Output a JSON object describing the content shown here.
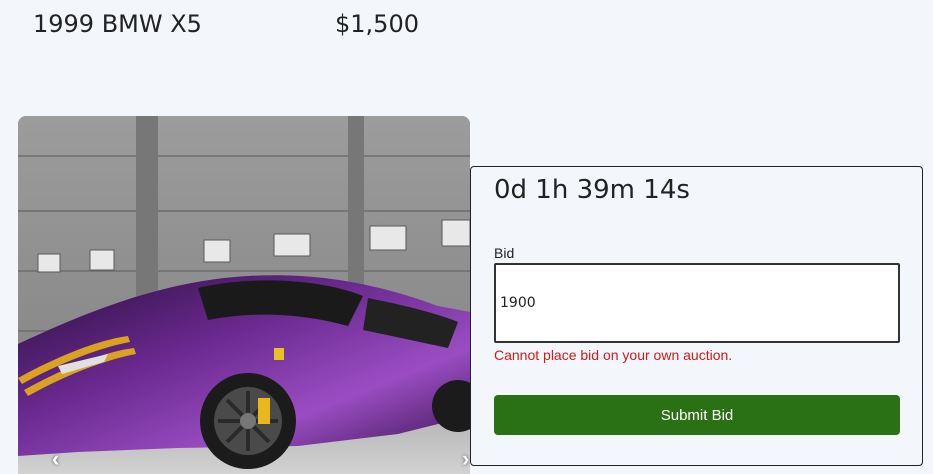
{
  "listing": {
    "title": "1999 BMW X5",
    "price": "$1,500"
  },
  "carousel": {
    "prev_arrow": "‹",
    "next_arrow": "›",
    "image_subject": "purple sports car in garage"
  },
  "bid_panel": {
    "countdown": "0d 1h 39m 14s",
    "bid_label": "Bid",
    "bid_value": "1900",
    "error_message": "Cannot place bid on your own auction.",
    "submit_label": "Submit Bid"
  },
  "colors": {
    "background": "#f3f6fb",
    "submit_button": "#2a7014",
    "error_text": "#d11a1a",
    "car_body": "#5a1f7a",
    "stripe": "#d9a320"
  }
}
